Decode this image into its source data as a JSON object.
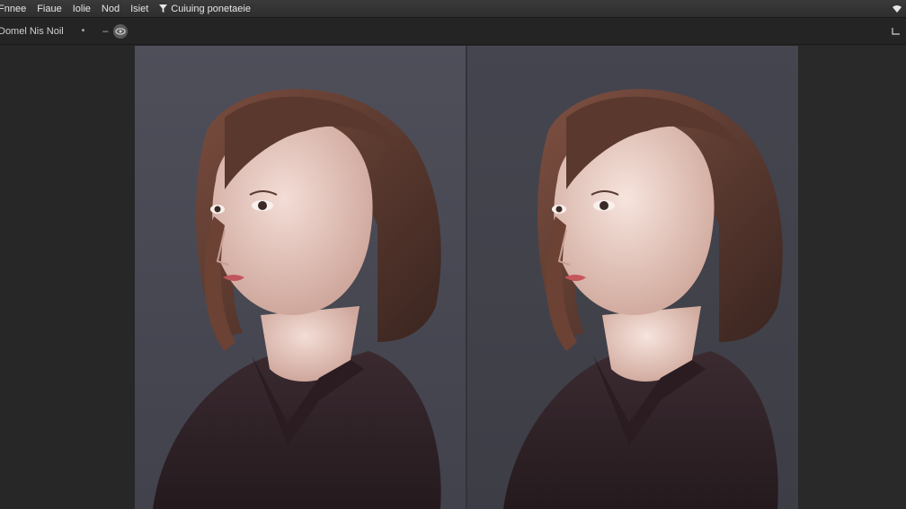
{
  "menubar": {
    "items": [
      "Fnnee",
      "Fiaue",
      "Iolie",
      "Nod",
      "Isiet"
    ],
    "filter_label": "Cuiuing ponetaeie"
  },
  "toolbar": {
    "document_title": "Domel Nis Noil",
    "separator": "•",
    "dash": "–"
  },
  "icons": {
    "filter": "filter-icon",
    "wifi": "wifi-icon",
    "eye": "eye-icon",
    "corner": "panel-toggle-icon"
  },
  "colors": {
    "canvas_bg": "#4a4a54",
    "hair": "#4a2e26",
    "sweater": "#2f2126"
  }
}
